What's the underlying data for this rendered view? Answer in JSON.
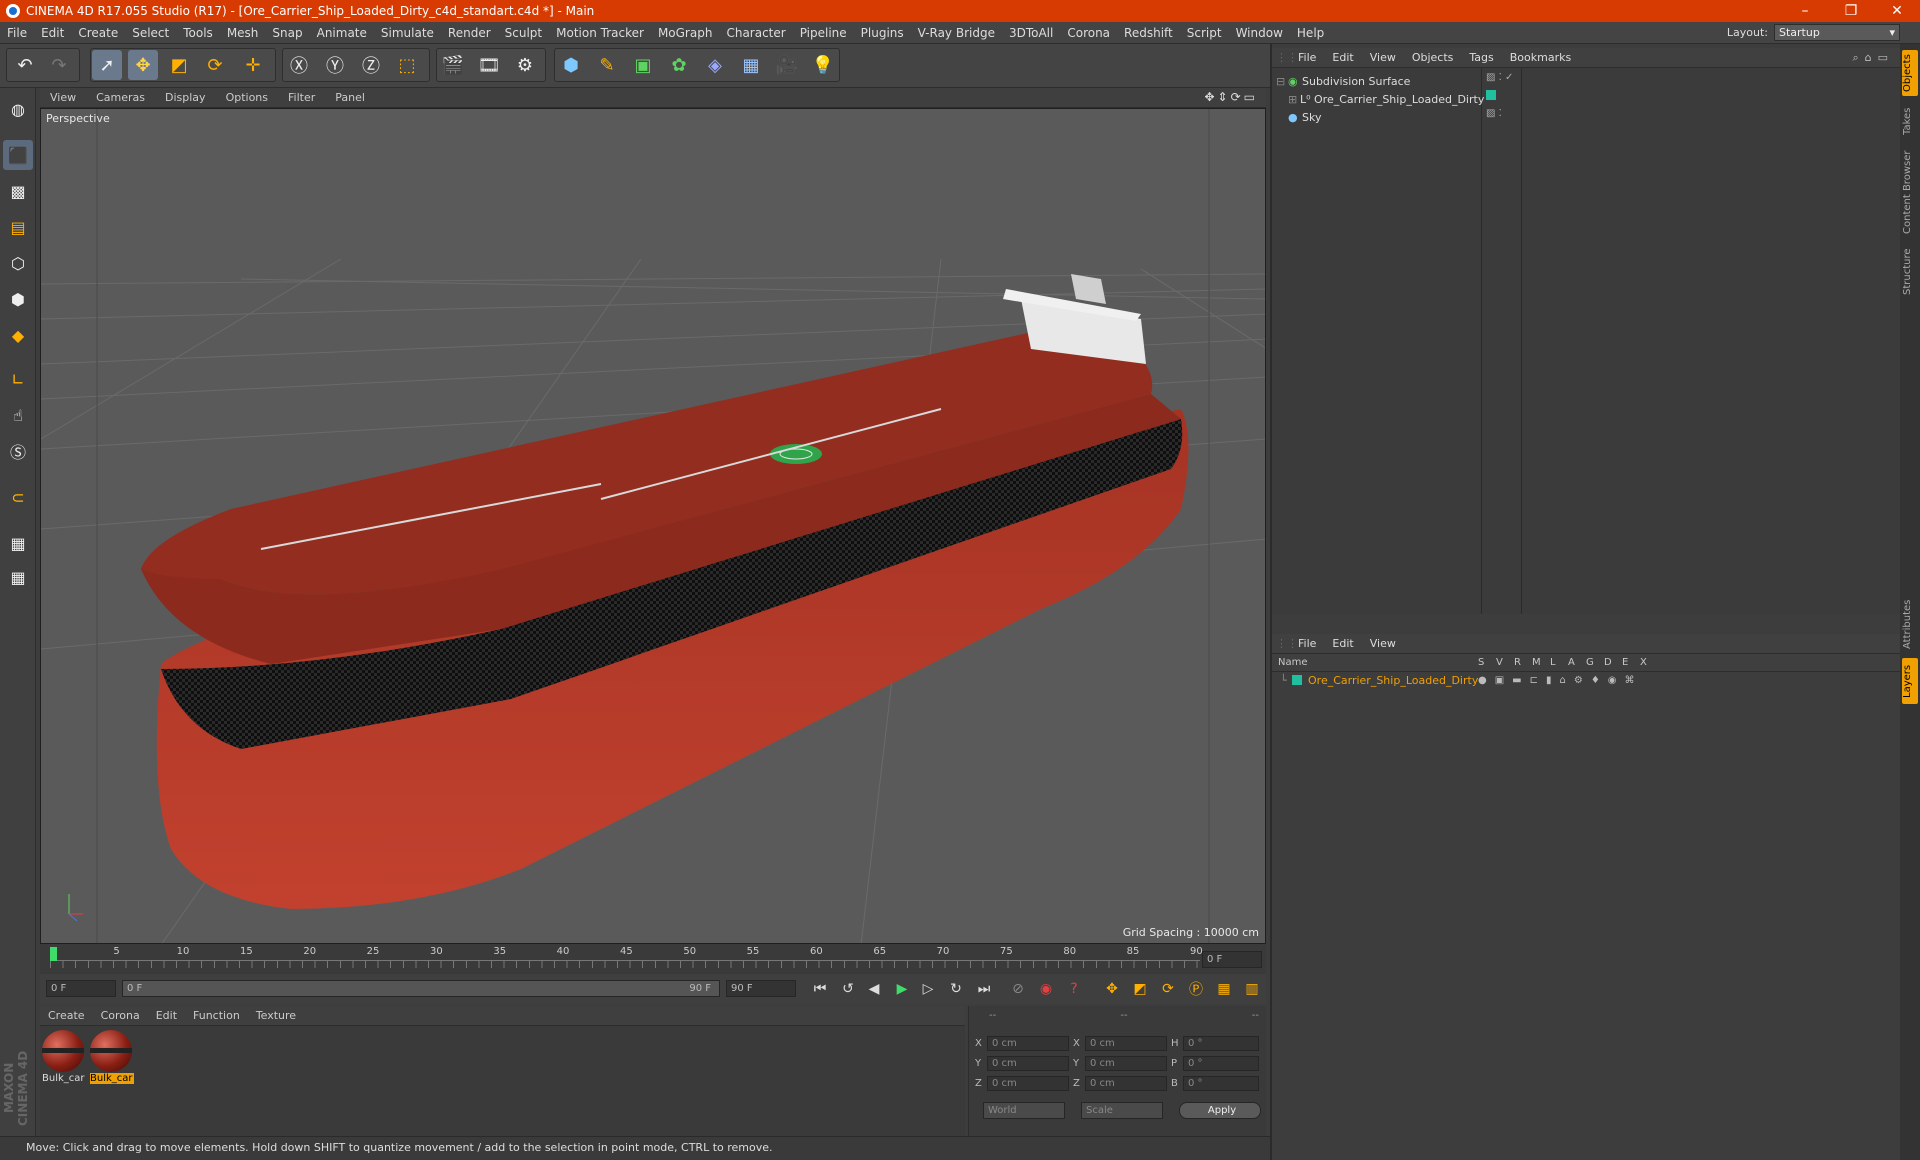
{
  "window": {
    "title": "CINEMA 4D R17.055 Studio (R17) - [Ore_Carrier_Ship_Loaded_Dirty_c4d_standart.c4d *] - Main"
  },
  "menubar": {
    "items": [
      "File",
      "Edit",
      "Create",
      "Select",
      "Tools",
      "Mesh",
      "Snap",
      "Animate",
      "Simulate",
      "Render",
      "Sculpt",
      "Motion Tracker",
      "MoGraph",
      "Character",
      "Pipeline",
      "Plugins",
      "V-Ray Bridge",
      "3DToAll",
      "Corona",
      "Redshift",
      "Script",
      "Window",
      "Help"
    ],
    "layout_label": "Layout:",
    "layout_value": "Startup"
  },
  "viewport": {
    "menu": [
      "View",
      "Cameras",
      "Display",
      "Options",
      "Filter",
      "Panel"
    ],
    "label": "Perspective",
    "grid_spacing": "Grid Spacing : 10000 cm"
  },
  "timeline": {
    "ticks": [
      "0",
      "5",
      "10",
      "15",
      "20",
      "25",
      "30",
      "35",
      "40",
      "45",
      "50",
      "55",
      "60",
      "65",
      "70",
      "75",
      "80",
      "85",
      "90"
    ],
    "current_frame": "0 F",
    "start_frame": "0 F",
    "range_start": "0 F",
    "range_end": "90 F",
    "end_frame": "90 F"
  },
  "material_manager": {
    "menu": [
      "Create",
      "Corona",
      "Edit",
      "Function",
      "Texture"
    ],
    "materials": [
      {
        "name": "Bulk_car",
        "selected": false
      },
      {
        "name": "Bulk_car",
        "selected": true
      }
    ]
  },
  "coordinates": {
    "headers": [
      "--",
      "--",
      "--"
    ],
    "rows": [
      {
        "a": "X",
        "av": "0 cm",
        "b": "X",
        "bv": "0 cm",
        "c": "H",
        "cv": "0 °"
      },
      {
        "a": "Y",
        "av": "0 cm",
        "b": "Y",
        "bv": "0 cm",
        "c": "P",
        "cv": "0 °"
      },
      {
        "a": "Z",
        "av": "0 cm",
        "b": "Z",
        "bv": "0 cm",
        "c": "B",
        "cv": "0 °"
      }
    ],
    "mode": "World",
    "type": "Scale",
    "apply": "Apply"
  },
  "object_manager": {
    "menu": [
      "File",
      "Edit",
      "View",
      "Objects",
      "Tags",
      "Bookmarks"
    ],
    "objects": [
      "Subdivision Surface",
      "Ore_Carrier_Ship_Loaded_Dirty",
      "Sky"
    ]
  },
  "layer_manager": {
    "menu": [
      "File",
      "Edit",
      "View"
    ],
    "columns": [
      "Name",
      "S",
      "V",
      "R",
      "M",
      "L",
      "A",
      "G",
      "D",
      "E",
      "X"
    ],
    "layer_name": "Ore_Carrier_Ship_Loaded_Dirty"
  },
  "side_tabs": [
    "Objects",
    "Takes",
    "Content Browser",
    "Structure",
    "Attributes",
    "Layers"
  ],
  "status": "Move: Click and drag to move elements. Hold down SHIFT to quantize movement / add to the selection in point mode, CTRL to remove.",
  "branding": {
    "logo": "MAXON CINEMA 4D"
  },
  "colors": {
    "titlebar": "#d83b01",
    "accent": "#f0a000",
    "layer_name": "#f0a000"
  }
}
